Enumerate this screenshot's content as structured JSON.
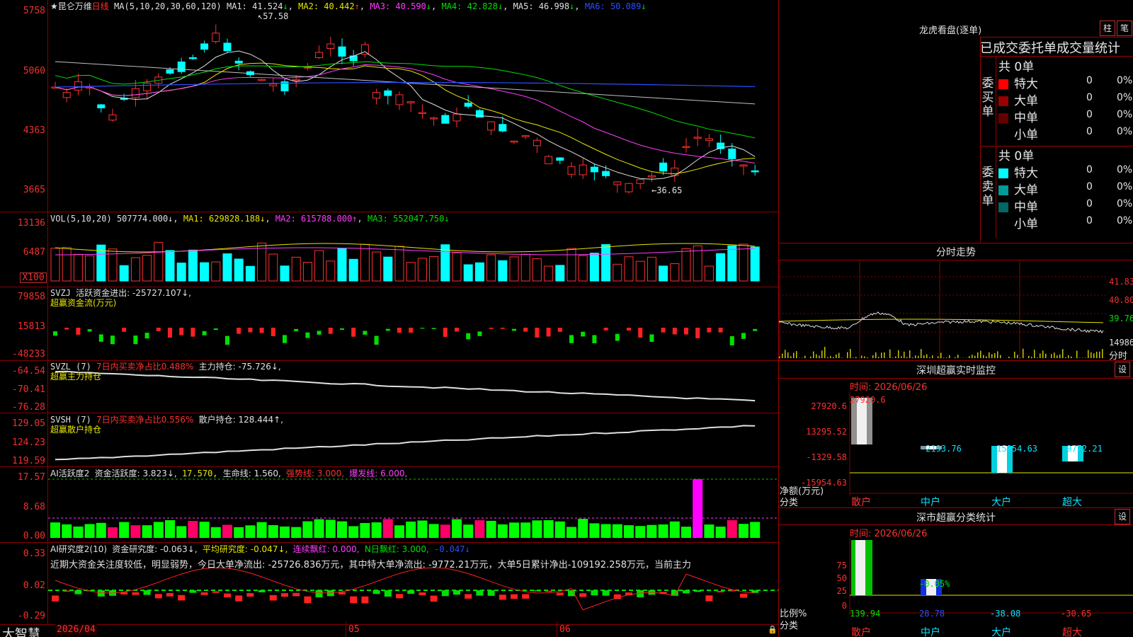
{
  "app": {
    "brand": "大智慧",
    "lock_icon": "lock-icon"
  },
  "main": {
    "title": "★昆仑万维",
    "period": "日线",
    "ma_label": "MA(5,10,20,30,60,120)",
    "ma1": "MA1: 41.524",
    "ma2": "MA2: 40.442",
    "ma3": "MA3: 40.590",
    "ma4": "MA4: 42.828",
    "ma5": "MA5: 46.998",
    "ma6": "MA6: 50.089",
    "arrows": [
      "↓",
      "↑",
      "↓",
      "↓",
      "↓",
      "↓"
    ],
    "yticks": [
      "5758",
      "5060",
      "4363",
      "3665"
    ],
    "high_label": "57.58",
    "low_label": "←36.65",
    "high_value": 57.58,
    "low_value": 36.65
  },
  "vol": {
    "label": "VOL(5,10,20)",
    "value": "507774.000↓",
    "ma1": "MA1: 629828.188↓",
    "ma2": "MA2: 615788.000↑",
    "ma3": "MA3: 552047.750↓",
    "yticks": [
      "13136",
      "6487"
    ],
    "unit": "X100"
  },
  "svzj": {
    "label": "SVZJ",
    "text": "活跃资金进出: -25727.107↓,",
    "sub": "超赢资金流(万元)",
    "yticks": [
      "79858",
      "15813",
      "-48233"
    ]
  },
  "svzl": {
    "label": "SVZL (7)",
    "text": "7日内买卖净占比0.488%",
    "text2": "主力持仓: -75.726↓,",
    "sub": "超赢主力持仓",
    "yticks": [
      "-64.54",
      "-70.41",
      "-76.28"
    ]
  },
  "svsh": {
    "label": "SVSH (7)",
    "text": "7日内买卖净占比0.556%",
    "text2": "散户持仓: 128.444↑,",
    "sub": "超赢散户持仓",
    "yticks": [
      "129.05",
      "124.23",
      "119.59"
    ]
  },
  "ai1": {
    "label": "AI活跃度2",
    "t1": "资金活跃度: 3.823↓,",
    "t2": "17.570,",
    "t3": "生命线: 1.560,",
    "t4": "强势线: 3.000,",
    "t5": "爆发线: 6.000,",
    "yticks": [
      "17.57",
      "8.68",
      "0.00"
    ]
  },
  "ai2": {
    "label": "AI研究度2(10)",
    "t1": "资金研究度: -0.063↓,",
    "t2": "平均研究度: -0.047↓,",
    "t3": "连续飘红: 0.000,",
    "t4": "N日飘红: 3.000,",
    "t5": "-0.047↓",
    "note": "近期大资金关注度较低，明显弱势，今日大单净流出: -25726.836万元，其中特大单净流出: -9772.21万元，大单5日累计净出-109192.258万元，当前主力",
    "yticks": [
      "0.33",
      "0.02",
      "-0.29"
    ]
  },
  "xaxis": [
    "2026/04",
    "05",
    "06"
  ],
  "right": {
    "lhb_title": "龙虎看盘(逐单)",
    "btn1": "柱",
    "btn2": "笔",
    "header": "已成交委托单成交量统计",
    "buy_label": "委买单",
    "sell_label": "委卖单",
    "buy_total": "共 0单",
    "sell_total": "共 0单",
    "buy_rows": [
      {
        "name": "特大",
        "v": "0",
        "p": "0%",
        "color": "#ff0000"
      },
      {
        "name": "大单",
        "v": "0",
        "p": "0%",
        "color": "#990000"
      },
      {
        "name": "中单",
        "v": "0",
        "p": "0%",
        "color": "#660000"
      },
      {
        "name": "小单",
        "v": "0",
        "p": "0%",
        "color": ""
      }
    ],
    "sell_rows": [
      {
        "name": "特大",
        "v": "0",
        "p": "0%",
        "color": "#00ffff"
      },
      {
        "name": "大单",
        "v": "0",
        "p": "0%",
        "color": "#009999"
      },
      {
        "name": "中单",
        "v": "0",
        "p": "0%",
        "color": "#006666"
      },
      {
        "name": "小单",
        "v": "0",
        "p": "0%",
        "color": ""
      }
    ],
    "fs_title": "分时走势",
    "fs_ticks": [
      "41.83",
      "40.80",
      "39.76",
      "14986"
    ],
    "fs_unit": "分时",
    "mon_title": "深圳超赢实时监控",
    "mon_set": "设",
    "mon_time": "时间: 2026/06/26",
    "mon_yticks": [
      "27920.6",
      "13295.52",
      "-1329.58",
      "-15954.63"
    ],
    "mon_ylabel": "净额(万元)",
    "mon_xlabel": "分类",
    "mon_values": [
      "27920.6",
      "-2193.76",
      "-15954.63",
      "-9772.21"
    ],
    "cats": [
      "散户",
      "中户",
      "大户",
      "超大"
    ],
    "cls_title": "深市超赢分类统计",
    "cls_set": "设",
    "cls_time": "时间: 2026/06/26",
    "cls_yticks": [
      "75",
      "50",
      "25",
      "0"
    ],
    "cls_ylabel": "比例%",
    "cls_xlabel": "分类",
    "cls_pct": "-0.05%",
    "cls_values": [
      "139.94",
      "28.78",
      "-38.08",
      "-30.65"
    ]
  }
}
